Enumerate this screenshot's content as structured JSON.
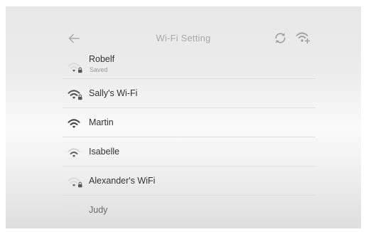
{
  "header": {
    "title": "Wi-Fi Setting",
    "back_icon": "arrow-left-icon",
    "refresh_icon": "refresh-icon",
    "add_network_icon": "wifi-add-icon"
  },
  "networks": [
    {
      "name": "Robelf",
      "status": "Saved",
      "secured": true,
      "signal": "weak"
    },
    {
      "name": "Sally's Wi-Fi",
      "secured": true,
      "signal": "strong"
    },
    {
      "name": "Martin",
      "secured": false,
      "signal": "strong"
    },
    {
      "name": "Isabelle",
      "secured": false,
      "signal": "medium"
    },
    {
      "name": "Alexander's WiFi",
      "secured": true,
      "signal": "weak"
    },
    {
      "name": "Judy",
      "secured": false,
      "signal": "faint"
    }
  ],
  "colors": {
    "text": "#333333",
    "title": "#a9a9a9",
    "icon": "#9e9e9e",
    "divider": "#dedede"
  }
}
